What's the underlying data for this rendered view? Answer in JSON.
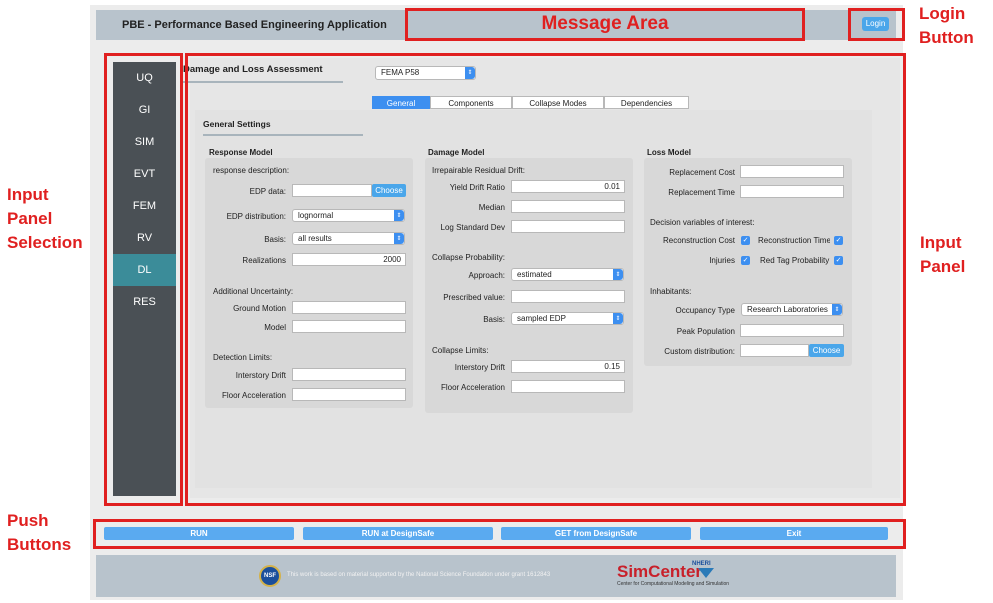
{
  "app": {
    "title": "PBE - Performance Based Engineering Application",
    "login_label": "Login"
  },
  "nav": {
    "items": [
      {
        "label": "UQ",
        "active": false
      },
      {
        "label": "GI",
        "active": false
      },
      {
        "label": "SIM",
        "active": false
      },
      {
        "label": "EVT",
        "active": false
      },
      {
        "label": "FEM",
        "active": false
      },
      {
        "label": "RV",
        "active": false
      },
      {
        "label": "DL",
        "active": true
      },
      {
        "label": "RES",
        "active": false
      }
    ]
  },
  "panel": {
    "title": "Damage and Loss Assessment",
    "method_select": "FEMA P58",
    "tabs": [
      {
        "label": "General",
        "active": true
      },
      {
        "label": "Components",
        "active": false
      },
      {
        "label": "Collapse Modes",
        "active": false
      },
      {
        "label": "Dependencies",
        "active": false
      }
    ],
    "general_settings_title": "General Settings"
  },
  "response_model": {
    "title": "Response Model",
    "response_description": "response description:",
    "edp_data_label": "EDP data:",
    "edp_data_value": "",
    "choose_label": "Choose",
    "edp_distribution_label": "EDP distribution:",
    "edp_distribution_value": "lognormal",
    "basis_label": "Basis:",
    "basis_value": "all results",
    "realizations_label": "Realizations",
    "realizations_value": "2000",
    "additional_uncertainty": "Additional Uncertainty:",
    "ground_motion_label": "Ground Motion",
    "model_label": "Model",
    "detection_limits": "Detection Limits:",
    "interstory_drift_label": "Interstory Drift",
    "floor_acceleration_label": "Floor Acceleration"
  },
  "damage_model": {
    "title": "Damage Model",
    "irreparable_residual_drift": "Irrepairable Residual Drift:",
    "yield_drift_ratio_label": "Yield Drift Ratio",
    "yield_drift_ratio_value": "0.01",
    "median_label": "Median",
    "log_std_dev_label": "Log Standard Dev",
    "collapse_probability": "Collapse Probability:",
    "approach_label": "Approach:",
    "approach_value": "estimated",
    "prescribed_value_label": "Prescribed value:",
    "basis_label": "Basis:",
    "basis_value": "sampled EDP",
    "collapse_limits": "Collapse Limits:",
    "interstory_drift_label": "Interstory Drift",
    "interstory_drift_value": "0.15",
    "floor_acceleration_label": "Floor Acceleration"
  },
  "loss_model": {
    "title": "Loss Model",
    "replacement_cost_label": "Replacement Cost",
    "replacement_time_label": "Replacement Time",
    "decision_variables": "Decision variables of interest:",
    "reconstruction_cost_label": "Reconstruction Cost",
    "reconstruction_time_label": "Reconstruction Time",
    "injuries_label": "Injuries",
    "red_tag_label": "Red Tag Probability",
    "inhabitants": "Inhabitants:",
    "occupancy_type_label": "Occupancy Type",
    "occupancy_type_value": "Research Laboratories",
    "peak_population_label": "Peak Population",
    "custom_distribution_label": "Custom distribution:",
    "choose_label": "Choose"
  },
  "push_buttons": {
    "run": "RUN",
    "run_designsafe": "RUN at DesignSafe",
    "get_designsafe": "GET from DesignSafe",
    "exit": "Exit"
  },
  "footer": {
    "nsf": "NSF",
    "text": "This work is based on material supported by the National Science Foundation under grant 1612843",
    "brand": "SimCenter",
    "nheri": "NHERI",
    "brand_sub": "Center for Computational Modeling and Simulation"
  },
  "annotations": {
    "message_area": "Message Area",
    "login_button": "Login Button",
    "input_panel_selection": "Input Panel Selection",
    "input_panel": "Input Panel",
    "push_buttons": "Push Buttons"
  },
  "colors": {
    "annotation": "#e02020",
    "accent": "#3d8ff0",
    "nav_bg": "#4a5055",
    "nav_active": "#3b8c99"
  }
}
